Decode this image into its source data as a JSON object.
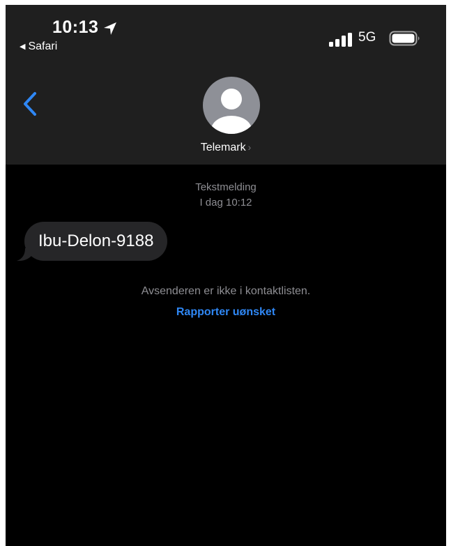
{
  "status_bar": {
    "time": "10:13",
    "back_app_label": "Safari",
    "network": "5G"
  },
  "header": {
    "contact_name": "Telemark"
  },
  "conversation": {
    "message_type": "Tekstmelding",
    "timestamp": "I dag 10:12",
    "messages": [
      {
        "text": "Ibu-Delon-9188",
        "direction": "incoming"
      }
    ],
    "unknown_sender_notice": "Avsenderen er ikke i kontaktlisten.",
    "report_link": "Rapporter uønsket"
  },
  "colors": {
    "header_bg": "#1f1f1f",
    "screen_bg": "#000000",
    "bubble_bg": "#262628",
    "accent": "#2f87f4",
    "secondary_text": "#8e8e93"
  }
}
